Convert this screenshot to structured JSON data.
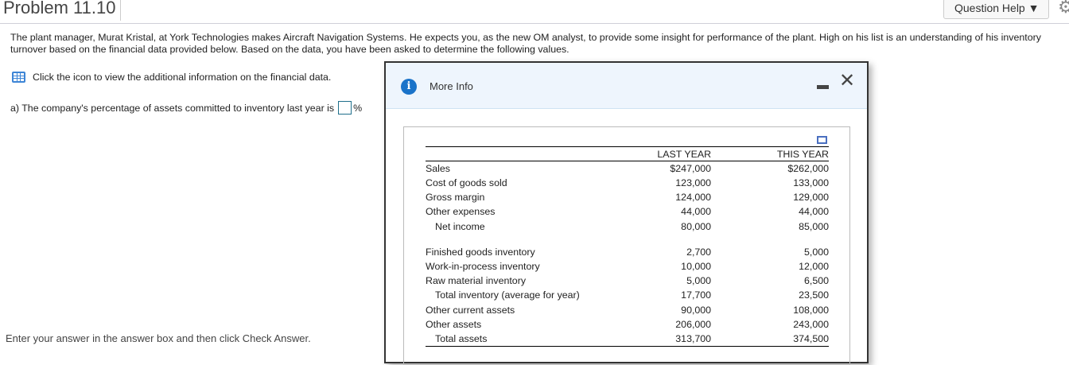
{
  "header": {
    "title": "Problem 11.10",
    "question_help": "Question Help ▼"
  },
  "intro": "The plant manager, Murat Kristal, at York Technologies makes Aircraft Navigation Systems. He expects you, as the new OM analyst, to provide some insight for performance of the plant. High on his list is an understanding of his inventory turnover based on the financial data provided below. Based on the data, you have been asked to determine the following values.",
  "icon_line": "Click the icon to view the additional information on the financial data.",
  "question_a": {
    "text": "a) The company's percentage of assets committed to inventory last year is",
    "value": "",
    "unit": "%"
  },
  "footer": "Enter your answer in the answer box and then click Check Answer.",
  "modal": {
    "title": "More Info",
    "columns": [
      "",
      "LAST YEAR",
      "THIS YEAR"
    ],
    "rows_income": [
      [
        "Sales",
        "$247,000",
        "$262,000"
      ],
      [
        "Cost of goods sold",
        "123,000",
        "133,000"
      ],
      [
        "Gross margin",
        "124,000",
        "129,000"
      ],
      [
        "Other expenses",
        "44,000",
        "44,000"
      ],
      [
        "Net income",
        "80,000",
        "85,000"
      ]
    ],
    "rows_assets": [
      [
        "Finished goods inventory",
        "2,700",
        "5,000"
      ],
      [
        "Work-in-process inventory",
        "10,000",
        "12,000"
      ],
      [
        "Raw material inventory",
        "5,000",
        "6,500"
      ],
      [
        "Total inventory (average for year)",
        "17,700",
        "23,500"
      ],
      [
        "Other current assets",
        "90,000",
        "108,000"
      ],
      [
        "Other assets",
        "206,000",
        "243,000"
      ],
      [
        "Total assets",
        "313,700",
        "374,500"
      ]
    ]
  }
}
